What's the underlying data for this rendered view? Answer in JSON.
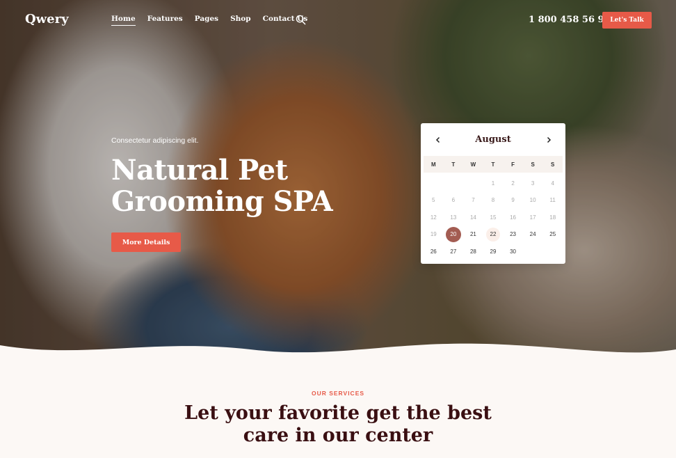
{
  "brand": {
    "logo": "Qwery",
    "accent": "#e75a48"
  },
  "nav": {
    "items": [
      {
        "label": "Home",
        "active": true
      },
      {
        "label": "Features"
      },
      {
        "label": "Pages"
      },
      {
        "label": "Shop"
      },
      {
        "label": "Contact Us"
      }
    ],
    "search_icon": "search-icon",
    "phone": "1 800 458 56 97",
    "cta": "Let's Talk"
  },
  "hero": {
    "tagline": "Consectetur adipiscing elit.",
    "headline": "Natural Pet Grooming SPA",
    "button": "More Details"
  },
  "calendar": {
    "month": "August",
    "weekdays": [
      "M",
      "T",
      "W",
      "T",
      "F",
      "S",
      "S"
    ],
    "leading_blanks": 3,
    "days": [
      1,
      2,
      3,
      4,
      5,
      6,
      7,
      8,
      9,
      10,
      11,
      12,
      13,
      14,
      15,
      16,
      17,
      18,
      19,
      20,
      21,
      22,
      23,
      24,
      25,
      26,
      27,
      28,
      29,
      30
    ],
    "first_available": 20,
    "selected": 20,
    "today": 22
  },
  "services": {
    "eyebrow": "OUR SERVICES",
    "title_line1": "Let your favorite get the best",
    "title_line2": "care in our center"
  }
}
